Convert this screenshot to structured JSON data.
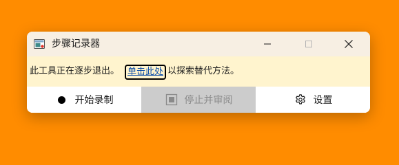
{
  "window": {
    "title": "步骤记录器",
    "icons": {
      "app": "steps-recorder-icon",
      "minimize": "minimize-icon",
      "maximize": "maximize-icon",
      "close": "close-icon"
    }
  },
  "notice": {
    "text_before": "此工具正在逐步退出。",
    "link_label": "单击此处",
    "text_after": "以探索替代方法。"
  },
  "toolbar": {
    "start_label": "开始录制",
    "start_icon": "record-icon",
    "stop_label": "停止并审阅",
    "stop_icon": "stop-icon",
    "stop_enabled": false,
    "settings_label": "设置",
    "settings_icon": "gear-icon"
  },
  "colors": {
    "background": "#FF8C00",
    "titlebar": "#F7EFE3",
    "notice_bar": "#FFF4CE",
    "link": "#0F4FA8",
    "disabled_button": "#CCCCCC"
  }
}
